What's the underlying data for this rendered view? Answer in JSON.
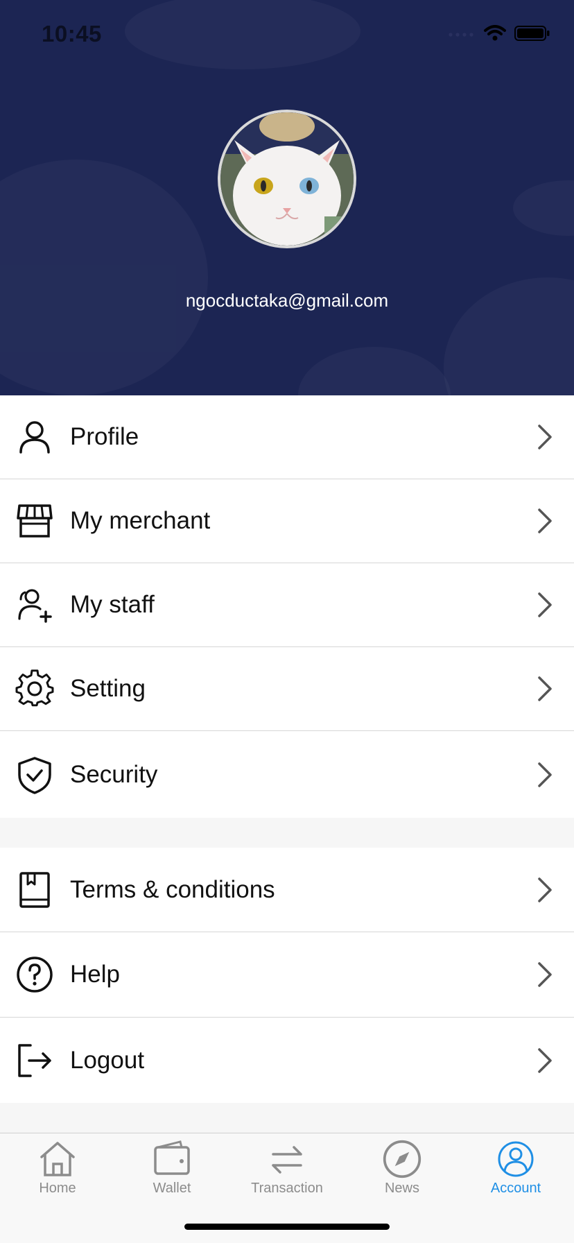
{
  "status_bar": {
    "time": "10:45"
  },
  "profile": {
    "email": "ngocductaka@gmail.com",
    "avatar": "cat-avatar"
  },
  "menu_group_1": [
    {
      "label": "Profile",
      "icon": "user-icon"
    },
    {
      "label": "My merchant",
      "icon": "store-icon"
    },
    {
      "label": "My staff",
      "icon": "user-add-icon"
    },
    {
      "label": "Setting",
      "icon": "gear-icon"
    },
    {
      "label": "Security",
      "icon": "shield-check-icon"
    }
  ],
  "menu_group_2": [
    {
      "label": "Terms & conditions",
      "icon": "book-icon"
    },
    {
      "label": "Help",
      "icon": "question-circle-icon"
    },
    {
      "label": "Logout",
      "icon": "logout-icon"
    }
  ],
  "tabbar": {
    "items": [
      {
        "label": "Home",
        "icon": "home-icon"
      },
      {
        "label": "Wallet",
        "icon": "wallet-icon"
      },
      {
        "label": "Transaction",
        "icon": "transfer-icon"
      },
      {
        "label": "News",
        "icon": "compass-icon"
      },
      {
        "label": "Account",
        "icon": "account-icon"
      }
    ],
    "active": "Account",
    "active_color": "#1f8fe5",
    "inactive_color": "#8c8c8c"
  },
  "colors": {
    "header_bg": "#1c2553"
  }
}
